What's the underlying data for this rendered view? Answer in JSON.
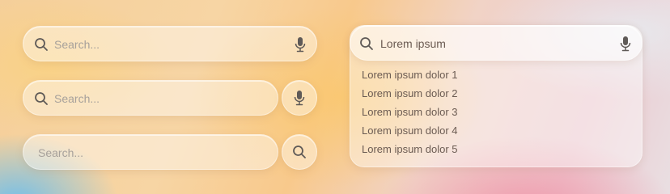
{
  "search_bars": {
    "bar1": {
      "placeholder": "Search...",
      "search_icon": "search-icon",
      "action_icon": "microphone-icon"
    },
    "bar2": {
      "placeholder": "Search...",
      "search_icon": "search-icon",
      "action_button_icon": "microphone-icon"
    },
    "bar3": {
      "placeholder": "Search...",
      "action_button_icon": "search-icon"
    }
  },
  "autocomplete": {
    "query": "Lorem ipsum",
    "search_icon": "search-icon",
    "action_icon": "microphone-icon",
    "suggestions": [
      "Lorem ipsum dolor 1",
      "Lorem ipsum dolor 2",
      "Lorem ipsum dolor 3",
      "Lorem ipsum dolor 4",
      "Lorem ipsum dolor 5"
    ]
  },
  "colors": {
    "icon": "#5f5a57",
    "placeholder": "#a7a19b",
    "text": "#6b5b52"
  }
}
